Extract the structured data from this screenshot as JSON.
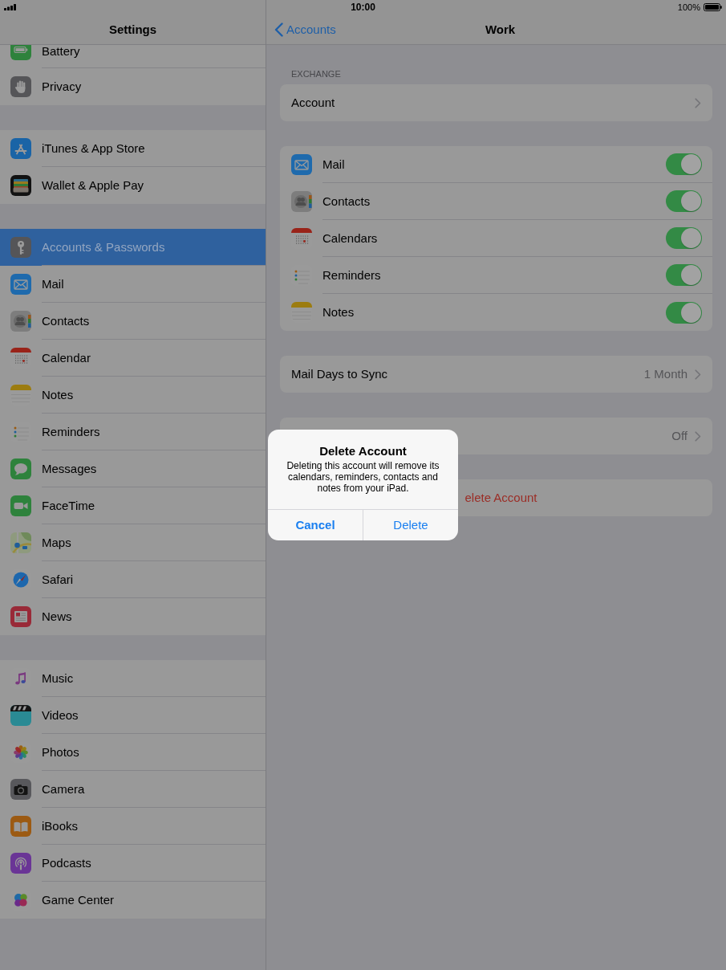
{
  "status_bar": {
    "time": "10:00",
    "battery": "100%"
  },
  "sidebar": {
    "title": "Settings",
    "groups": [
      {
        "items": [
          {
            "label": "Battery",
            "selected": false
          },
          {
            "label": "Privacy",
            "selected": false
          }
        ]
      },
      {
        "items": [
          {
            "label": "iTunes & App Store",
            "selected": false
          },
          {
            "label": "Wallet & Apple Pay",
            "selected": false
          }
        ]
      },
      {
        "items": [
          {
            "label": "Accounts & Passwords",
            "selected": true
          },
          {
            "label": "Mail",
            "selected": false
          },
          {
            "label": "Contacts",
            "selected": false
          },
          {
            "label": "Calendar",
            "selected": false
          },
          {
            "label": "Notes",
            "selected": false
          },
          {
            "label": "Reminders",
            "selected": false
          },
          {
            "label": "Messages",
            "selected": false
          },
          {
            "label": "FaceTime",
            "selected": false
          },
          {
            "label": "Maps",
            "selected": false
          },
          {
            "label": "Safari",
            "selected": false
          },
          {
            "label": "News",
            "selected": false
          }
        ]
      },
      {
        "items": [
          {
            "label": "Music",
            "selected": false
          },
          {
            "label": "Videos",
            "selected": false
          },
          {
            "label": "Photos",
            "selected": false
          },
          {
            "label": "Camera",
            "selected": false
          },
          {
            "label": "iBooks",
            "selected": false
          },
          {
            "label": "Podcasts",
            "selected": false
          },
          {
            "label": "Game Center",
            "selected": false
          }
        ]
      }
    ]
  },
  "detail": {
    "back": "Accounts",
    "title": "Work",
    "section_header": "EXCHANGE",
    "account_row": {
      "label": "Account"
    },
    "services": [
      {
        "label": "Mail",
        "on": true
      },
      {
        "label": "Contacts",
        "on": true
      },
      {
        "label": "Calendars",
        "on": true
      },
      {
        "label": "Reminders",
        "on": true
      },
      {
        "label": "Notes",
        "on": true
      }
    ],
    "sync_row": {
      "label": "Mail Days to Sync",
      "value": "1 Month"
    },
    "reply_row": {
      "value": "Off"
    },
    "delete_row": {
      "label": "elete Account"
    }
  },
  "alert": {
    "title": "Delete Account",
    "message": "Deleting this account will remove its calendars, reminders, contacts and notes from your iPad.",
    "buttons": [
      {
        "label": "Cancel",
        "kind": "cancel"
      },
      {
        "label": "Delete",
        "kind": "action"
      }
    ]
  }
}
